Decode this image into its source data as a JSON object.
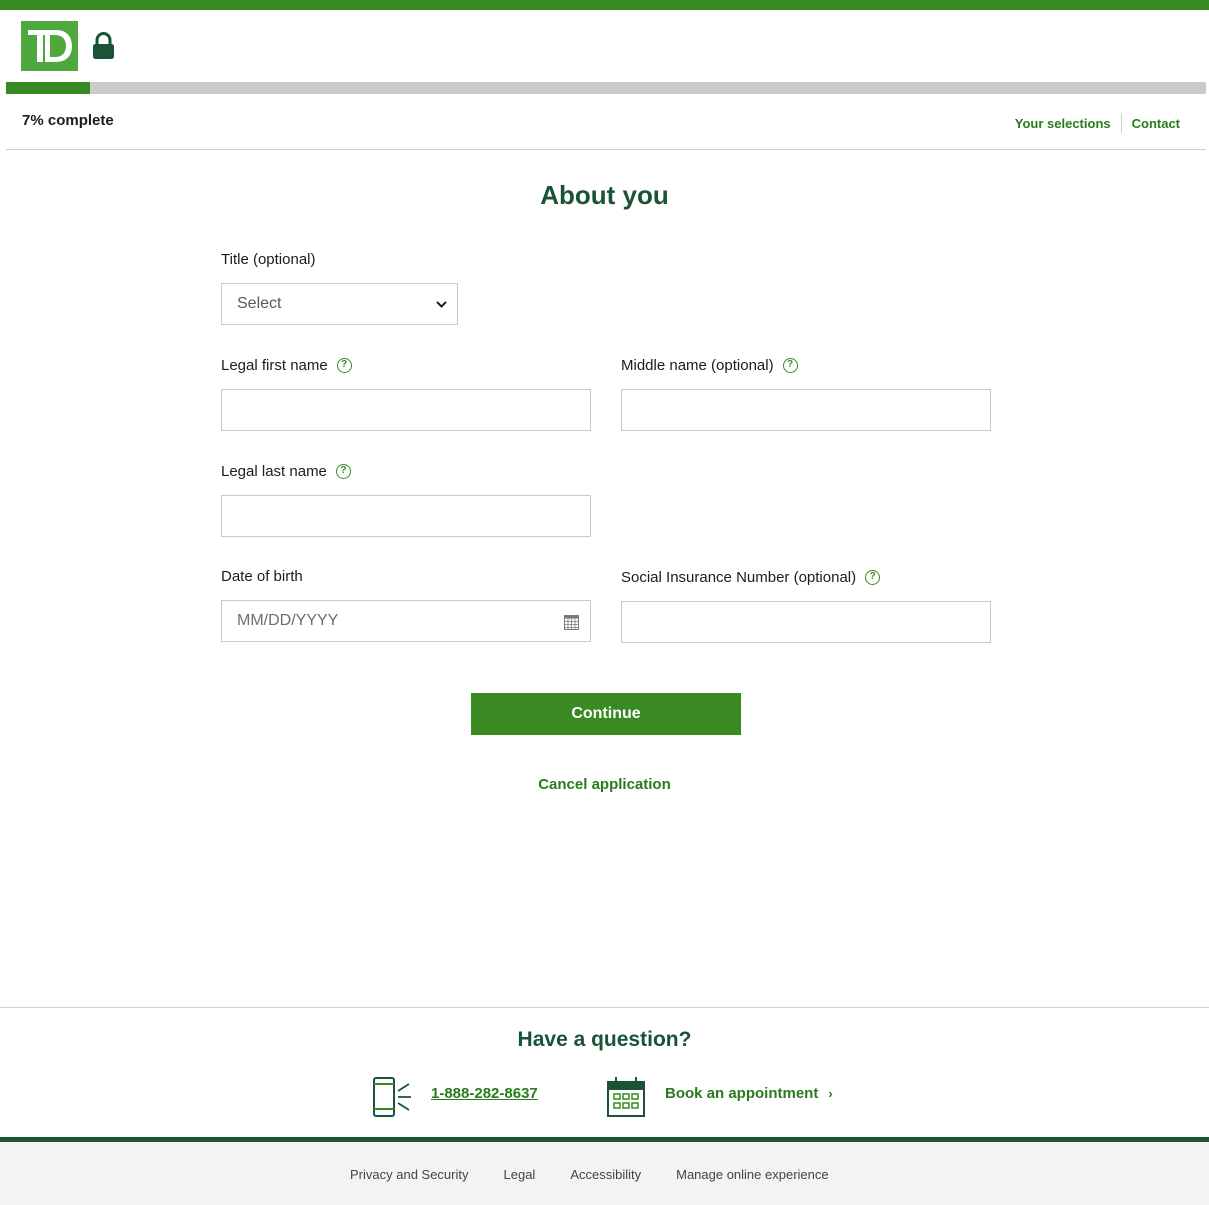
{
  "header": {
    "logo_text": "TD",
    "progress_percent": 7,
    "progress_label": "7% complete",
    "links": [
      "Your selections",
      "Contact"
    ]
  },
  "form": {
    "title": "About you",
    "title_label": "Title (optional)",
    "title_select_value": "Select",
    "first_name_label": "Legal first name",
    "middle_name_label": "Middle name (optional)",
    "last_name_label": "Legal last name",
    "dob_label": "Date of birth",
    "dob_placeholder": "MM/DD/YYYY",
    "sin_label": "Social Insurance Number (optional)",
    "continue_label": "Continue",
    "cancel_label": "Cancel application"
  },
  "question": {
    "title": "Have a question?",
    "phone": "1-888-282-8637",
    "appointment": "Book an appointment",
    "appointment_arrow": "›"
  },
  "footer": {
    "links": [
      "Privacy and Security",
      "Legal",
      "Accessibility",
      "Manage online experience"
    ]
  },
  "colors": {
    "brand_green": "#3a8a23",
    "logo_green": "#4fa83d",
    "dark_green": "#1a5336"
  },
  "icons": [
    "td-logo",
    "lock-icon",
    "chevron-down-icon",
    "help-icon",
    "calendar-icon",
    "phone-icon",
    "calendar-large-icon",
    "chevron-right-icon"
  ]
}
